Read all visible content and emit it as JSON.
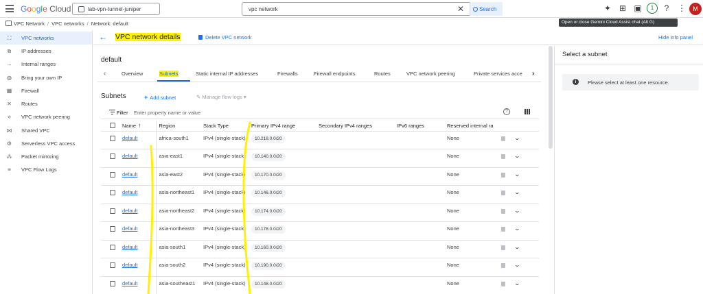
{
  "topbar": {
    "brand": "Google Cloud",
    "project": "lab-vpn-tunnel-juniper",
    "search_value": "vpc network",
    "search_button": "Search",
    "notifications_count": "1",
    "avatar_letter": "M",
    "tooltip": "Open or close Gemini Cloud Assist chat (Alt G)"
  },
  "breadcrumb": [
    "VPC Network",
    "VPC networks",
    "Network: default"
  ],
  "sidebar": {
    "items": [
      {
        "label": "VPC networks",
        "icon": "vpc-networks-icon",
        "active": true
      },
      {
        "label": "IP addresses",
        "icon": "ip-addresses-icon"
      },
      {
        "label": "Internal ranges",
        "icon": "internal-ranges-icon"
      },
      {
        "label": "Bring your own IP",
        "icon": "byoip-icon"
      },
      {
        "label": "Firewall",
        "icon": "firewall-icon"
      },
      {
        "label": "Routes",
        "icon": "routes-icon"
      },
      {
        "label": "VPC network peering",
        "icon": "peering-icon"
      },
      {
        "label": "Shared VPC",
        "icon": "shared-vpc-icon"
      },
      {
        "label": "Serverless VPC access",
        "icon": "serverless-icon"
      },
      {
        "label": "Packet mirroring",
        "icon": "packet-mirroring-icon"
      },
      {
        "label": "VPC Flow Logs",
        "icon": "flow-logs-icon"
      }
    ]
  },
  "header": {
    "title": "VPC network details",
    "delete_label": "Delete VPC network",
    "hide_panel_label": "Hide info panel"
  },
  "network": {
    "name": "default"
  },
  "tabs": [
    {
      "label": "Overview"
    },
    {
      "label": "Subnets",
      "selected": true
    },
    {
      "label": "Static internal IP addresses"
    },
    {
      "label": "Firewalls"
    },
    {
      "label": "Firewall endpoints"
    },
    {
      "label": "Routes"
    },
    {
      "label": "VPC network peering"
    },
    {
      "label": "Private services acce"
    }
  ],
  "subnets": {
    "heading": "Subnets",
    "add_label": "Add subnet",
    "manage_label": "Manage flow logs",
    "filter_label": "Filter",
    "filter_placeholder": "Enter property name or value",
    "columns": [
      "Name",
      "Region",
      "Stack Type",
      "Primary IPv4 range",
      "Secondary IPv4 ranges",
      "IPv6 ranges",
      "Reserved internal ra"
    ],
    "rows": [
      {
        "name": "default",
        "region": "africa-south1",
        "stack": "IPv4 (single-stack)",
        "primary": "10.218.0.0/20",
        "secondary": "",
        "ipv6": "",
        "reserved": "None"
      },
      {
        "name": "default",
        "region": "asia-east1",
        "stack": "IPv4 (single-stack)",
        "primary": "10.140.0.0/20",
        "secondary": "",
        "ipv6": "",
        "reserved": "None"
      },
      {
        "name": "default",
        "region": "asia-east2",
        "stack": "IPv4 (single-stack)",
        "primary": "10.170.0.0/20",
        "secondary": "",
        "ipv6": "",
        "reserved": "None"
      },
      {
        "name": "default",
        "region": "asia-northeast1",
        "stack": "IPv4 (single-stack)",
        "primary": "10.146.0.0/20",
        "secondary": "",
        "ipv6": "",
        "reserved": "None"
      },
      {
        "name": "default",
        "region": "asia-northeast2",
        "stack": "IPv4 (single-stack)",
        "primary": "10.174.0.0/20",
        "secondary": "",
        "ipv6": "",
        "reserved": "None"
      },
      {
        "name": "default",
        "region": "asia-northeast3",
        "stack": "IPv4 (single-stack)",
        "primary": "10.178.0.0/20",
        "secondary": "",
        "ipv6": "",
        "reserved": "None"
      },
      {
        "name": "default",
        "region": "asia-south1",
        "stack": "IPv4 (single-stack)",
        "primary": "10.160.0.0/20",
        "secondary": "",
        "ipv6": "",
        "reserved": "None"
      },
      {
        "name": "default",
        "region": "asia-south2",
        "stack": "IPv4 (single-stack)",
        "primary": "10.190.0.0/20",
        "secondary": "",
        "ipv6": "",
        "reserved": "None"
      },
      {
        "name": "default",
        "region": "asia-southeast1",
        "stack": "IPv4 (single-stack)",
        "primary": "10.148.0.0/20",
        "secondary": "",
        "ipv6": "",
        "reserved": "None"
      }
    ]
  },
  "info_panel": {
    "title": "Select a subnet",
    "message": "Please select at least one resource."
  },
  "colors": {
    "accent": "#1a73e8",
    "highlight": "#fff100",
    "active_bg": "#e8f0fe"
  }
}
